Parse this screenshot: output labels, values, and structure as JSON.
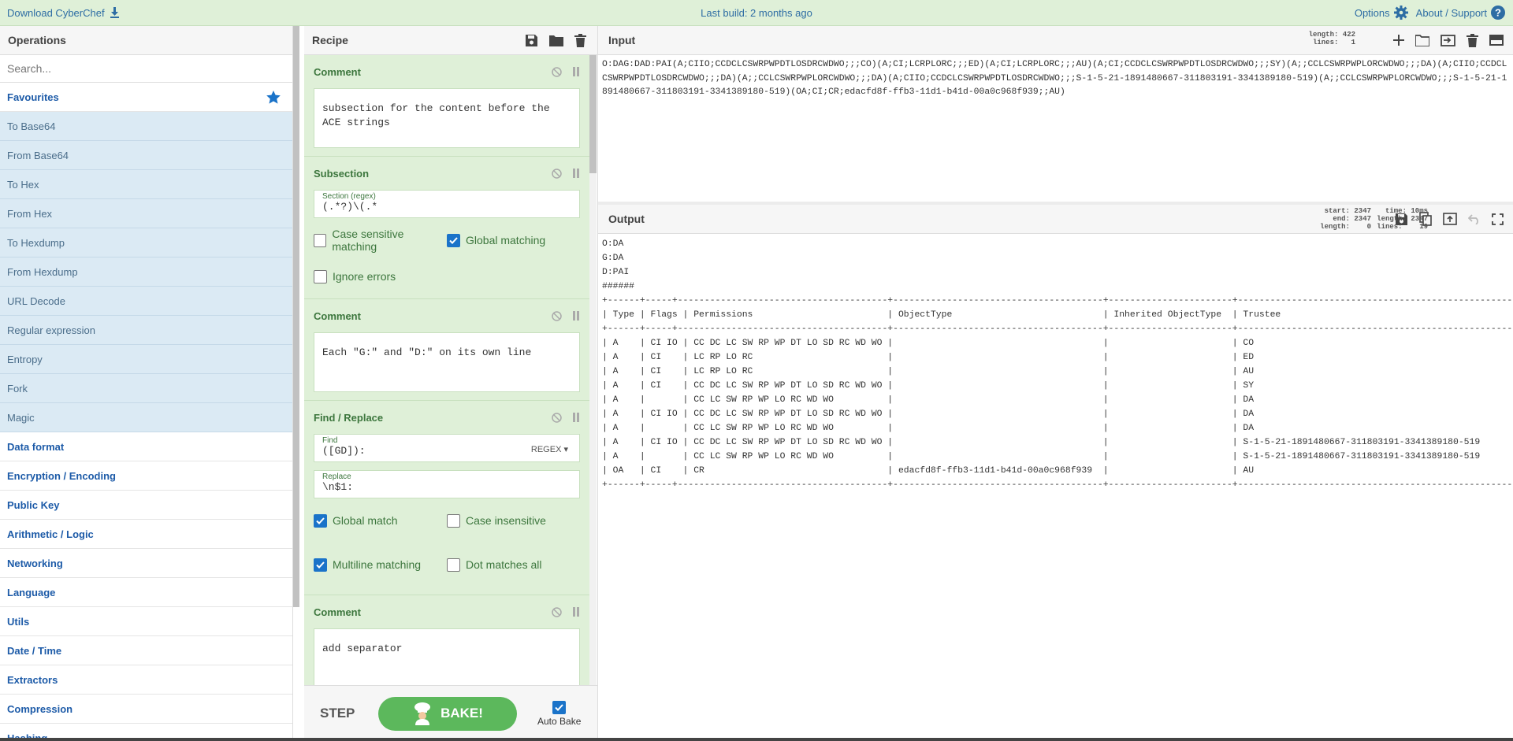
{
  "banner": {
    "download_label": "Download CyberChef",
    "last_build": "Last build: 2 months ago",
    "options_label": "Options",
    "about_label": "About / Support",
    "download_icon": "download-icon",
    "options_icon": "gear-icon",
    "about_icon": "question-icon"
  },
  "operations": {
    "title": "Operations",
    "search_placeholder": "Search...",
    "favourites_label": "Favourites",
    "favourites": [
      "To Base64",
      "From Base64",
      "To Hex",
      "From Hex",
      "To Hexdump",
      "From Hexdump",
      "URL Decode",
      "Regular expression",
      "Entropy",
      "Fork",
      "Magic"
    ],
    "categories": [
      "Data format",
      "Encryption / Encoding",
      "Public Key",
      "Arithmetic / Logic",
      "Networking",
      "Language",
      "Utils",
      "Date / Time",
      "Extractors",
      "Compression",
      "Hashing"
    ]
  },
  "recipe": {
    "title": "Recipe",
    "steps": [
      {
        "name": "Comment",
        "text": "subsection for the content before the ACE strings"
      },
      {
        "name": "Subsection",
        "section_label": "Section (regex)",
        "section_value": "(.*?)\\(.*",
        "case_sensitive_label": "Case sensitive matching",
        "case_sensitive": false,
        "global_label": "Global matching",
        "global": true,
        "ignore_errors_label": "Ignore errors",
        "ignore_errors": false
      },
      {
        "name": "Comment",
        "text": "Each \"G:\" and \"D:\" on its own line"
      },
      {
        "name": "Find / Replace",
        "find_label": "Find",
        "find_value": "([GD]):",
        "find_mode": "REGEX",
        "replace_label": "Replace",
        "replace_value": "\\n$1:",
        "global_label": "Global match",
        "global": true,
        "case_insensitive_label": "Case insensitive",
        "case_insensitive": false,
        "multiline_label": "Multiline matching",
        "multiline": true,
        "dotall_label": "Dot matches all",
        "dotall": false
      },
      {
        "name": "Comment",
        "text": "add separator"
      }
    ],
    "step_label": "STEP",
    "bake_label": "BAKE!",
    "auto_bake_label": "Auto Bake",
    "auto_bake": true
  },
  "input": {
    "title": "Input",
    "length_label": "length:",
    "length": "422",
    "lines_label": "lines:",
    "lines": "1",
    "text": "O:DAG:DAD:PAI(A;CIIO;CCDCLCSWRPWPDTLOSDRCWDWO;;;CO)(A;CI;LCRPLORC;;;ED)(A;CI;LCRPLORC;;;AU)(A;CI;CCDCLCSWRPWPDTLOSDRCWDWO;;;SY)(A;;CCLCSWRPWPLORCWDWO;;;DA)(A;CIIO;CCDCLCSWRPWPDTLOSDRCWDWO;;;DA)(A;;CCLCSWRPWPLORCWDWO;;;DA)(A;CIIO;CCDCLCSWRPWPDTLOSDRCWDWO;;;S-1-5-21-1891480667-311803191-3341389180-519)(A;;CCLCSWRPWPLORCWDWO;;;S-1-5-21-1891480667-311803191-3341389180-519)(OA;CI;CR;edacfd8f-ffb3-11d1-b41d-00a0c968f939;;AU)"
  },
  "output": {
    "title": "Output",
    "start_label": "start:",
    "start": "2347",
    "end_label": "end:",
    "end": "2347",
    "length_label": "length:",
    "length": "0",
    "time_label": "time:",
    "time": "10ms",
    "out_length_label": "length:",
    "out_length": "2347",
    "lines_label": "lines:",
    "lines": "19",
    "text": "O:DA\nG:DA\nD:PAI\n######\n+------+-----+---------------------------------------+---------------------------------------+-----------------------+---------------------------------------------------------------+\n| Type | Flags | Permissions                         | ObjectType                            | Inherited ObjectType  | Trustee                                                       |\n+------+-----+---------------------------------------+---------------------------------------+-----------------------+---------------------------------------------------------------+\n| A    | CI IO | CC DC LC SW RP WP DT LO SD RC WD WO |                                       |                       | CO                                                            |\n| A    | CI    | LC RP LO RC                         |                                       |                       | ED                                                            |\n| A    | CI    | LC RP LO RC                         |                                       |                       | AU                                                            |\n| A    | CI    | CC DC LC SW RP WP DT LO SD RC WD WO |                                       |                       | SY                                                            |\n| A    |       | CC LC SW RP WP LO RC WD WO          |                                       |                       | DA                                                            |\n| A    | CI IO | CC DC LC SW RP WP DT LO SD RC WD WO |                                       |                       | DA                                                            |\n| A    |       | CC LC SW RP WP LO RC WD WO          |                                       |                       | DA                                                            |\n| A    | CI IO | CC DC LC SW RP WP DT LO SD RC WD WO |                                       |                       | S-1-5-21-1891480667-311803191-3341389180-519                  |\n| A    |       | CC LC SW RP WP LO RC WD WO          |                                       |                       | S-1-5-21-1891480667-311803191-3341389180-519                  |\n| OA   | CI    | CR                                  | edacfd8f-ffb3-11d1-b41d-00a0c968f939  |                       | AU                                                            |\n+------+-----+---------------------------------------+---------------------------------------+-----------------------+---------------------------------------------------------------+"
  },
  "colors": {
    "accent": "#1d5ba8",
    "recipe_bg": "#dff0d8",
    "bake": "#5cb85c"
  }
}
